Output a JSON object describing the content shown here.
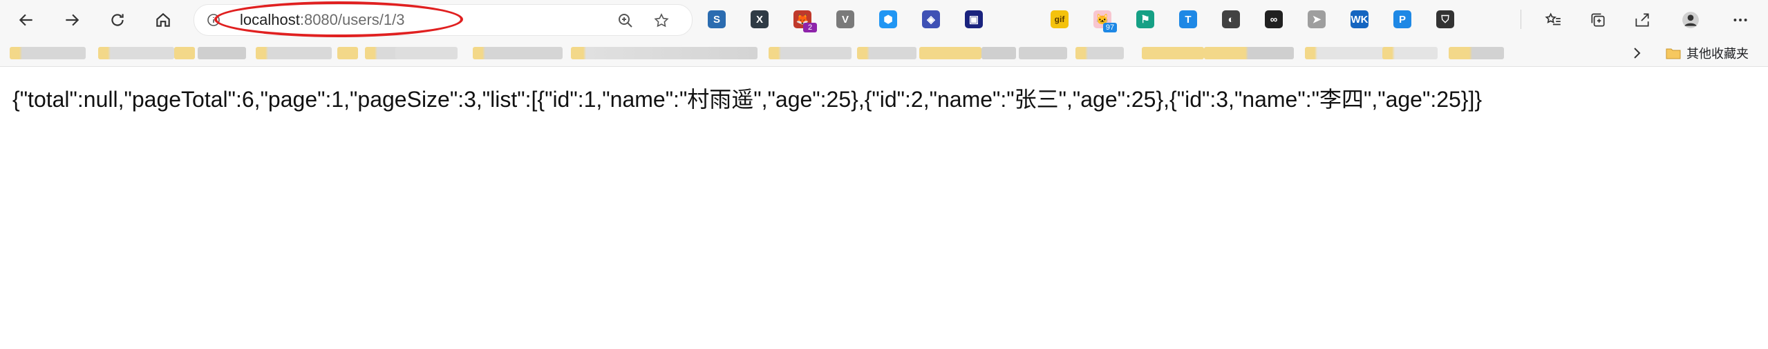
{
  "browser": {
    "address_bar": {
      "host": "localhost",
      "path": ":8080/users/1/3"
    },
    "nav": [
      "back",
      "forward",
      "refresh",
      "home"
    ],
    "extensions": [
      {
        "icon": "s-extension-icon",
        "glyph": "S",
        "color": "#2b6cb0"
      },
      {
        "icon": "x-extension-icon",
        "glyph": "X",
        "color": "#2f3b45"
      },
      {
        "icon": "pet-extension-icon",
        "glyph": "🦊",
        "color": "#c0392b",
        "badge": "2"
      },
      {
        "icon": "vue-extension-icon",
        "glyph": "V",
        "color": "#7a7a7a"
      },
      {
        "icon": "hex-extension-icon",
        "glyph": "⬢",
        "color": "#2196f3"
      },
      {
        "icon": "cube-extension-icon",
        "glyph": "◈",
        "color": "#3f51b5"
      },
      {
        "icon": "bookmark-extension-icon",
        "glyph": "▣",
        "color": "#1a237e"
      },
      {
        "icon": "blank-extension-icon",
        "glyph": "",
        "color": "#eeeeee"
      },
      {
        "icon": "gif-extension-icon",
        "glyph": "gif",
        "color": "#f4c20d"
      },
      {
        "icon": "cat-extension-icon",
        "glyph": "🐱",
        "color": "#f8c6d0",
        "badge": "97"
      },
      {
        "icon": "flag-extension-icon",
        "glyph": "⚑",
        "color": "#16a085"
      },
      {
        "icon": "t-extension-icon",
        "glyph": "T",
        "color": "#1e88e5"
      },
      {
        "icon": "circle-extension-icon",
        "glyph": "◐",
        "color": "#424242"
      },
      {
        "icon": "link-extension-icon",
        "glyph": "∞",
        "color": "#212121"
      },
      {
        "icon": "cursor-extension-icon",
        "glyph": "➤",
        "color": "#9e9e9e"
      },
      {
        "icon": "wk-extension-icon",
        "glyph": "WK",
        "color": "#1565c0"
      },
      {
        "icon": "p-extension-icon",
        "glyph": "P",
        "color": "#1e88e5"
      },
      {
        "icon": "shield-extension-icon",
        "glyph": "⛉",
        "color": "#333333"
      }
    ],
    "bookmarks_other_label": "其他收藏夹"
  },
  "page": {
    "response_text": "{\"total\":null,\"pageTotal\":6,\"page\":1,\"pageSize\":3,\"list\":[{\"id\":1,\"name\":\"村雨遥\",\"age\":25},{\"id\":2,\"name\":\"张三\",\"age\":25},{\"id\":3,\"name\":\"李四\",\"age\":25}]}"
  }
}
